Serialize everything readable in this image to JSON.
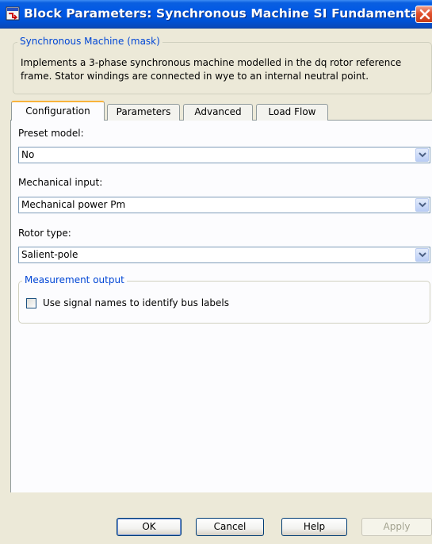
{
  "window": {
    "title": "Block Parameters: Synchronous Machine SI Fundamental"
  },
  "mask": {
    "group_label": "Synchronous Machine (mask)",
    "description": "Implements a 3-phase synchronous machine modelled in the dq rotor reference frame. Stator windings are connected in wye to an internal neutral point."
  },
  "tabs": [
    {
      "label": "Configuration",
      "active": true
    },
    {
      "label": "Parameters",
      "active": false
    },
    {
      "label": "Advanced",
      "active": false
    },
    {
      "label": "Load Flow",
      "active": false
    }
  ],
  "config": {
    "preset_model": {
      "label": "Preset model:",
      "value": "No"
    },
    "mechanical_input": {
      "label": "Mechanical input:",
      "value": "Mechanical power Pm"
    },
    "rotor_type": {
      "label": "Rotor type:",
      "value": "Salient-pole"
    },
    "measurement": {
      "group_label": "Measurement output",
      "checkbox_label": "Use signal names to identify bus labels",
      "checked": false
    }
  },
  "buttons": {
    "ok": "OK",
    "cancel": "Cancel",
    "help": "Help",
    "apply": "Apply"
  },
  "colors": {
    "titlebar": "#0058e6",
    "active_tab_accent": "#f8b33b",
    "group_label": "#0046d5"
  },
  "icons": {
    "title_icon": "simulink-block-icon",
    "close": "close-icon",
    "dropdown": "chevron-down-icon"
  }
}
